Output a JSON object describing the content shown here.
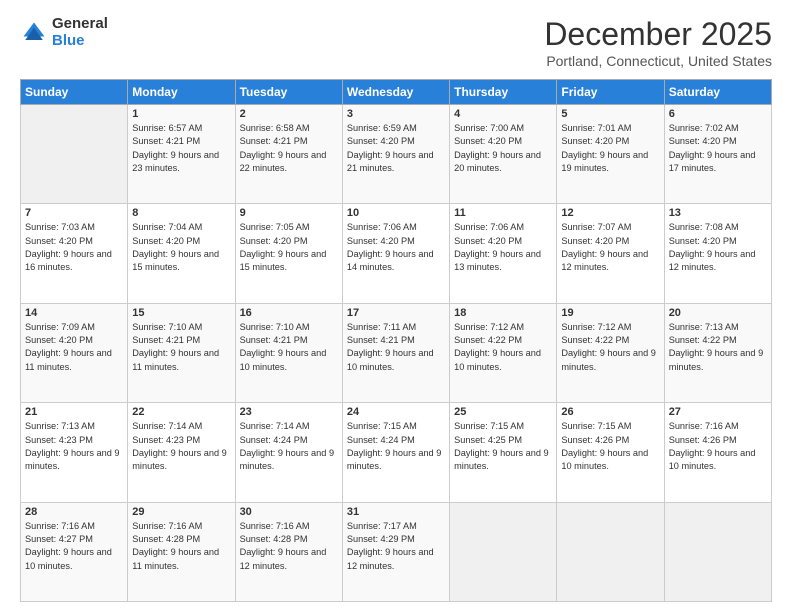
{
  "logo": {
    "general": "General",
    "blue": "Blue"
  },
  "header": {
    "month": "December 2025",
    "location": "Portland, Connecticut, United States"
  },
  "days_of_week": [
    "Sunday",
    "Monday",
    "Tuesday",
    "Wednesday",
    "Thursday",
    "Friday",
    "Saturday"
  ],
  "weeks": [
    [
      {
        "day": "",
        "sunrise": "",
        "sunset": "",
        "daylight": ""
      },
      {
        "day": "1",
        "sunrise": "Sunrise: 6:57 AM",
        "sunset": "Sunset: 4:21 PM",
        "daylight": "Daylight: 9 hours and 23 minutes."
      },
      {
        "day": "2",
        "sunrise": "Sunrise: 6:58 AM",
        "sunset": "Sunset: 4:21 PM",
        "daylight": "Daylight: 9 hours and 22 minutes."
      },
      {
        "day": "3",
        "sunrise": "Sunrise: 6:59 AM",
        "sunset": "Sunset: 4:20 PM",
        "daylight": "Daylight: 9 hours and 21 minutes."
      },
      {
        "day": "4",
        "sunrise": "Sunrise: 7:00 AM",
        "sunset": "Sunset: 4:20 PM",
        "daylight": "Daylight: 9 hours and 20 minutes."
      },
      {
        "day": "5",
        "sunrise": "Sunrise: 7:01 AM",
        "sunset": "Sunset: 4:20 PM",
        "daylight": "Daylight: 9 hours and 19 minutes."
      },
      {
        "day": "6",
        "sunrise": "Sunrise: 7:02 AM",
        "sunset": "Sunset: 4:20 PM",
        "daylight": "Daylight: 9 hours and 17 minutes."
      }
    ],
    [
      {
        "day": "7",
        "sunrise": "Sunrise: 7:03 AM",
        "sunset": "Sunset: 4:20 PM",
        "daylight": "Daylight: 9 hours and 16 minutes."
      },
      {
        "day": "8",
        "sunrise": "Sunrise: 7:04 AM",
        "sunset": "Sunset: 4:20 PM",
        "daylight": "Daylight: 9 hours and 15 minutes."
      },
      {
        "day": "9",
        "sunrise": "Sunrise: 7:05 AM",
        "sunset": "Sunset: 4:20 PM",
        "daylight": "Daylight: 9 hours and 15 minutes."
      },
      {
        "day": "10",
        "sunrise": "Sunrise: 7:06 AM",
        "sunset": "Sunset: 4:20 PM",
        "daylight": "Daylight: 9 hours and 14 minutes."
      },
      {
        "day": "11",
        "sunrise": "Sunrise: 7:06 AM",
        "sunset": "Sunset: 4:20 PM",
        "daylight": "Daylight: 9 hours and 13 minutes."
      },
      {
        "day": "12",
        "sunrise": "Sunrise: 7:07 AM",
        "sunset": "Sunset: 4:20 PM",
        "daylight": "Daylight: 9 hours and 12 minutes."
      },
      {
        "day": "13",
        "sunrise": "Sunrise: 7:08 AM",
        "sunset": "Sunset: 4:20 PM",
        "daylight": "Daylight: 9 hours and 12 minutes."
      }
    ],
    [
      {
        "day": "14",
        "sunrise": "Sunrise: 7:09 AM",
        "sunset": "Sunset: 4:20 PM",
        "daylight": "Daylight: 9 hours and 11 minutes."
      },
      {
        "day": "15",
        "sunrise": "Sunrise: 7:10 AM",
        "sunset": "Sunset: 4:21 PM",
        "daylight": "Daylight: 9 hours and 11 minutes."
      },
      {
        "day": "16",
        "sunrise": "Sunrise: 7:10 AM",
        "sunset": "Sunset: 4:21 PM",
        "daylight": "Daylight: 9 hours and 10 minutes."
      },
      {
        "day": "17",
        "sunrise": "Sunrise: 7:11 AM",
        "sunset": "Sunset: 4:21 PM",
        "daylight": "Daylight: 9 hours and 10 minutes."
      },
      {
        "day": "18",
        "sunrise": "Sunrise: 7:12 AM",
        "sunset": "Sunset: 4:22 PM",
        "daylight": "Daylight: 9 hours and 10 minutes."
      },
      {
        "day": "19",
        "sunrise": "Sunrise: 7:12 AM",
        "sunset": "Sunset: 4:22 PM",
        "daylight": "Daylight: 9 hours and 9 minutes."
      },
      {
        "day": "20",
        "sunrise": "Sunrise: 7:13 AM",
        "sunset": "Sunset: 4:22 PM",
        "daylight": "Daylight: 9 hours and 9 minutes."
      }
    ],
    [
      {
        "day": "21",
        "sunrise": "Sunrise: 7:13 AM",
        "sunset": "Sunset: 4:23 PM",
        "daylight": "Daylight: 9 hours and 9 minutes."
      },
      {
        "day": "22",
        "sunrise": "Sunrise: 7:14 AM",
        "sunset": "Sunset: 4:23 PM",
        "daylight": "Daylight: 9 hours and 9 minutes."
      },
      {
        "day": "23",
        "sunrise": "Sunrise: 7:14 AM",
        "sunset": "Sunset: 4:24 PM",
        "daylight": "Daylight: 9 hours and 9 minutes."
      },
      {
        "day": "24",
        "sunrise": "Sunrise: 7:15 AM",
        "sunset": "Sunset: 4:24 PM",
        "daylight": "Daylight: 9 hours and 9 minutes."
      },
      {
        "day": "25",
        "sunrise": "Sunrise: 7:15 AM",
        "sunset": "Sunset: 4:25 PM",
        "daylight": "Daylight: 9 hours and 9 minutes."
      },
      {
        "day": "26",
        "sunrise": "Sunrise: 7:15 AM",
        "sunset": "Sunset: 4:26 PM",
        "daylight": "Daylight: 9 hours and 10 minutes."
      },
      {
        "day": "27",
        "sunrise": "Sunrise: 7:16 AM",
        "sunset": "Sunset: 4:26 PM",
        "daylight": "Daylight: 9 hours and 10 minutes."
      }
    ],
    [
      {
        "day": "28",
        "sunrise": "Sunrise: 7:16 AM",
        "sunset": "Sunset: 4:27 PM",
        "daylight": "Daylight: 9 hours and 10 minutes."
      },
      {
        "day": "29",
        "sunrise": "Sunrise: 7:16 AM",
        "sunset": "Sunset: 4:28 PM",
        "daylight": "Daylight: 9 hours and 11 minutes."
      },
      {
        "day": "30",
        "sunrise": "Sunrise: 7:16 AM",
        "sunset": "Sunset: 4:28 PM",
        "daylight": "Daylight: 9 hours and 12 minutes."
      },
      {
        "day": "31",
        "sunrise": "Sunrise: 7:17 AM",
        "sunset": "Sunset: 4:29 PM",
        "daylight": "Daylight: 9 hours and 12 minutes."
      },
      {
        "day": "",
        "sunrise": "",
        "sunset": "",
        "daylight": ""
      },
      {
        "day": "",
        "sunrise": "",
        "sunset": "",
        "daylight": ""
      },
      {
        "day": "",
        "sunrise": "",
        "sunset": "",
        "daylight": ""
      }
    ]
  ]
}
